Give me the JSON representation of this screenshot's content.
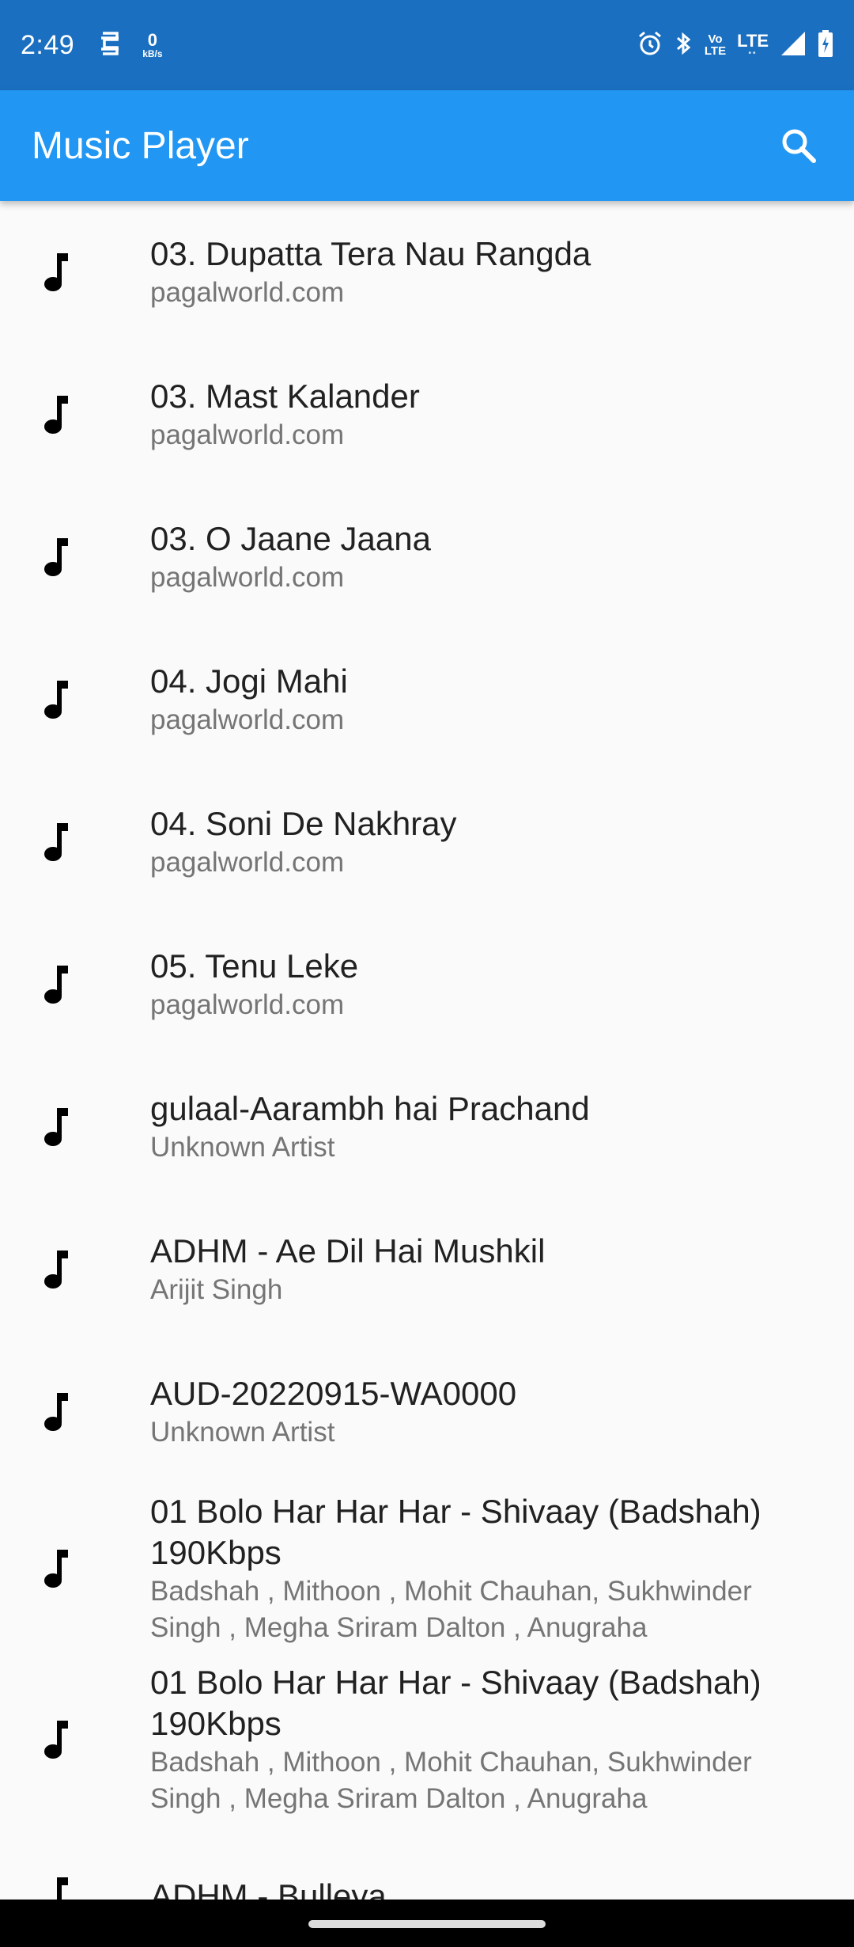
{
  "status_bar": {
    "time": "2:49",
    "net_speed_value": "0",
    "net_speed_unit": "kB/s",
    "volte_top": "Vo",
    "volte_bottom": "LTE",
    "lte": "LTE"
  },
  "app_bar": {
    "title": "Music Player",
    "search_icon": "search-icon"
  },
  "songs": [
    {
      "title": "03. Dupatta Tera Nau Rangda",
      "artist": "pagalworld.com"
    },
    {
      "title": "03. Mast Kalander",
      "artist": "pagalworld.com"
    },
    {
      "title": "03. O Jaane Jaana",
      "artist": "pagalworld.com"
    },
    {
      "title": "04. Jogi Mahi",
      "artist": "pagalworld.com"
    },
    {
      "title": "04. Soni De Nakhray",
      "artist": "pagalworld.com"
    },
    {
      "title": "05. Tenu Leke",
      "artist": "pagalworld.com"
    },
    {
      "title": "gulaal-Aarambh hai Prachand",
      "artist": "Unknown Artist"
    },
    {
      "title": "ADHM - Ae Dil Hai Mushkil",
      "artist": "Arijit Singh"
    },
    {
      "title": "AUD-20220915-WA0000",
      "artist": "Unknown Artist"
    },
    {
      "title": "01 Bolo Har Har Har - Shivaay (Badshah) 190Kbps",
      "artist": "Badshah , Mithoon , Mohit Chauhan, Sukhwinder Singh , Megha Sriram Dalton , Anugraha"
    },
    {
      "title": "01 Bolo Har Har Har - Shivaay (Badshah) 190Kbps",
      "artist": "Badshah , Mithoon , Mohit Chauhan, Sukhwinder Singh , Megha Sriram Dalton , Anugraha"
    },
    {
      "title": "ADHM - Bulleya",
      "artist": ""
    }
  ],
  "colors": {
    "status_bar": "#1b6fc0",
    "app_bar": "#2196f3",
    "background": "#fafafa",
    "title_text": "#212121",
    "subtitle_text": "#757575"
  }
}
